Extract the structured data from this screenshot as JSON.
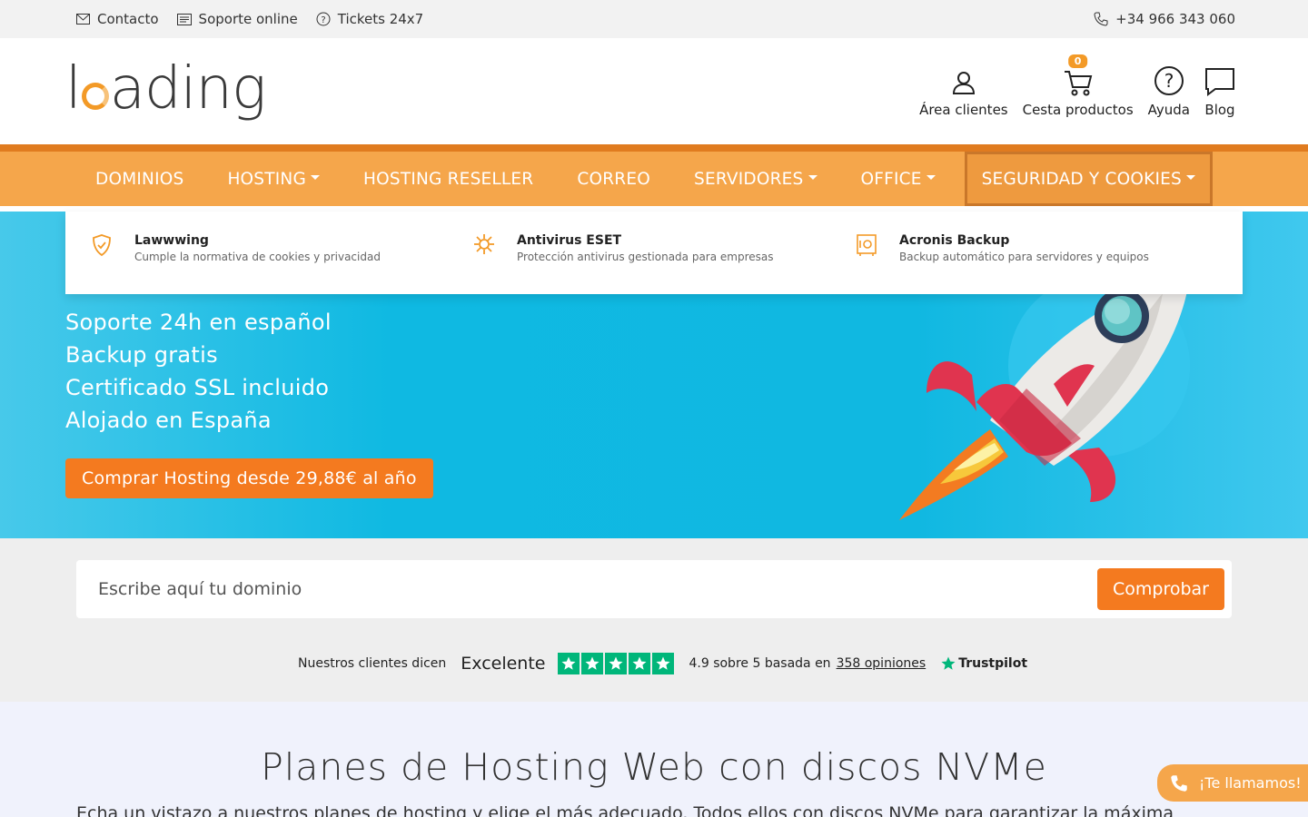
{
  "topbar": {
    "contact": "Contacto",
    "support": "Soporte online",
    "tickets": "Tickets 24x7",
    "phone": "+34 966 343 060"
  },
  "logo": {
    "pre": "l",
    "post": "ading"
  },
  "header_nav": {
    "clients": "Área clientes",
    "cart": "Cesta productos",
    "cart_count": "0",
    "help": "Ayuda",
    "blog": "Blog"
  },
  "menu": [
    {
      "label": "DOMINIOS"
    },
    {
      "label": "HOSTING"
    },
    {
      "label": "HOSTING RESELLER"
    },
    {
      "label": "CORREO"
    },
    {
      "label": "SERVIDORES"
    },
    {
      "label": "OFFICE"
    },
    {
      "label": "SEGURIDAD Y COOKIES"
    }
  ],
  "dropdown": [
    {
      "title": "Lawwwing",
      "desc": "Cumple la normativa de cookies y privacidad"
    },
    {
      "title": "Antivirus ESET",
      "desc": "Protección antivirus gestionada para empresas"
    },
    {
      "title": "Acronis Backup",
      "desc": "Backup automático para servidores y equipos"
    }
  ],
  "hero": {
    "lines": [
      "Soporte 24h en español",
      "Backup gratis",
      "Certificado SSL incluido",
      "Alojado en España"
    ],
    "cta": "Comprar Hosting desde 29,88€ al año"
  },
  "domain_search": {
    "placeholder": "Escribe aquí tu dominio",
    "button": "Comprobar"
  },
  "trustpilot": {
    "intro": "Nuestros clientes dicen",
    "rating_word": "Excelente",
    "score_text": "4.9 sobre 5 basada en",
    "reviews_link": "358 opiniones",
    "brand": "Trustpilot",
    "stars": 5
  },
  "plans": {
    "title": "Planes de Hosting Web con discos NVMe",
    "subtitle": "Echa un vistazo a nuestros planes de hosting y elige el más adecuado. Todos ellos con discos NVMe para garantizar la máxima"
  },
  "callback": "¡Te llamamos!",
  "colors": {
    "orange": "#f47a1f",
    "menu": "#f5a64b",
    "hero": "#10b8e1",
    "trustpilot": "#00b67a"
  }
}
